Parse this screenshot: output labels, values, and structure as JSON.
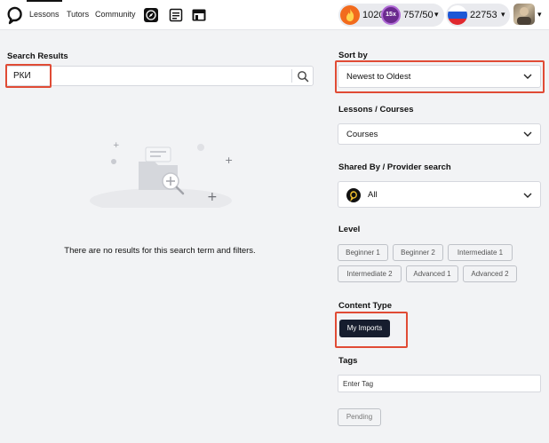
{
  "nav": {
    "links": [
      {
        "label": "Lessons",
        "active": true
      },
      {
        "label": "Tutors",
        "active": false
      },
      {
        "label": "Community",
        "active": false
      }
    ],
    "icons": [
      "compass-icon",
      "reader-icon",
      "store-icon"
    ],
    "streak": "1020",
    "multiplier": "15x",
    "xp": "757/50",
    "coins": "22753",
    "flag_colors": [
      "#ffffff",
      "#1c57d6",
      "#e0282e"
    ]
  },
  "search": {
    "label": "Search Results",
    "value": "РКИ",
    "empty_message": "There are no results for this search term and filters."
  },
  "filters": {
    "sort_label": "Sort by",
    "sort_value": "Newest to Oldest",
    "type_label": "Lessons / Courses",
    "type_value": "Courses",
    "provider_label": "Shared By / Provider search",
    "provider_value": "All",
    "level_label": "Level",
    "levels": [
      "Beginner 1",
      "Beginner 2",
      "Intermediate 1",
      "Intermediate 2",
      "Advanced 1",
      "Advanced 2"
    ],
    "content_type_label": "Content Type",
    "content_type_button": "My Imports",
    "tags_label": "Tags",
    "tags_placeholder": "Enter Tag",
    "pending_button": "Pending"
  },
  "colors": {
    "accent_dark": "#161d2e",
    "highlight_red": "#e04b35",
    "flame": "#f26b1d",
    "multiplier": "#6a2a8e"
  }
}
